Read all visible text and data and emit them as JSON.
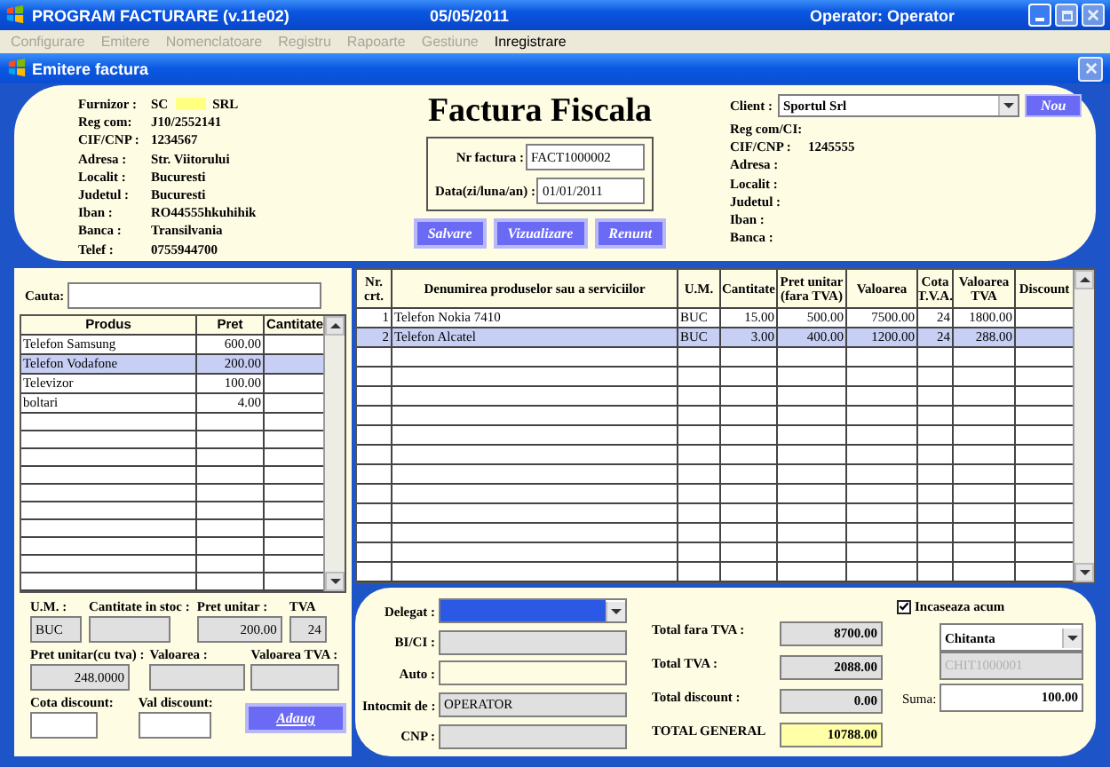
{
  "app": {
    "title": "PROGRAM FACTURARE  (v.11e02)",
    "date": "05/05/2011",
    "operator": "Operator:  Operator"
  },
  "menu": [
    {
      "label": "Configurare",
      "disabled": true
    },
    {
      "label": "Emitere",
      "disabled": true
    },
    {
      "label": "Nomenclatoare",
      "disabled": true
    },
    {
      "label": "Registru",
      "disabled": true
    },
    {
      "label": "Rapoarte",
      "disabled": true
    },
    {
      "label": "Gestiune",
      "disabled": true
    },
    {
      "label": "Inregistrare",
      "disabled": false
    }
  ],
  "window": {
    "title": "Emitere factura"
  },
  "supplier": [
    {
      "label": "Furnizor :",
      "value": "SC",
      "redacted": true,
      "suffix": "SRL"
    },
    {
      "label": "Reg com:",
      "value": "J10/2552141"
    },
    {
      "label": "CIF/CNP :",
      "value": "1234567"
    },
    {
      "label": "Adresa :",
      "value": "Str. Viitorului"
    },
    {
      "label": "Localit :",
      "value": "Bucuresti"
    },
    {
      "label": "Judetul :",
      "value": "Bucuresti"
    },
    {
      "label": "Iban :",
      "value": "RO44555hkuhihik"
    },
    {
      "label": "Banca :",
      "value": "Transilvania"
    },
    {
      "label": "Telef :",
      "value": "0755944700"
    }
  ],
  "invoice": {
    "title": "Factura Fiscala",
    "fields": [
      {
        "label": "Nr factura :",
        "value": "FACT1000002"
      },
      {
        "label": "Data(zi/luna/an) :",
        "value": "01/01/2011"
      }
    ],
    "buttons": [
      "Salvare",
      "Vizualizare",
      "Renunt"
    ]
  },
  "client": {
    "label": "Client :",
    "value": "Sportul Srl",
    "button": "Nou",
    "fields": [
      {
        "label": "Reg com/CI:"
      },
      {
        "label": "CIF/CNP :",
        "value": "1245555"
      },
      {
        "label": "Adresa :"
      },
      {
        "label": "Localit :"
      },
      {
        "label": "Judetul :"
      },
      {
        "label": "Iban :"
      },
      {
        "label": "Banca :"
      }
    ]
  },
  "products": {
    "search_label": "Cauta:",
    "columns": [
      "Produs",
      "Pret",
      "Cantitate"
    ],
    "rows": [
      {
        "cells": [
          "Telefon Samsung",
          "600.00"
        ],
        "selected": false
      },
      {
        "cells": [
          "Telefon Vodafone",
          "200.00"
        ],
        "selected": true
      },
      {
        "cells": [
          "Televizor",
          "100.00"
        ],
        "selected": false
      },
      {
        "cells": [
          "boltari",
          "4.00"
        ],
        "selected": false
      }
    ]
  },
  "product_detail": {
    "rows": [
      [
        {
          "label": "U.M. :",
          "value": "BUC"
        },
        {
          "label": "Cantitate in stoc :"
        },
        {
          "label": "Pret unitar :",
          "value": "200.00"
        },
        {
          "label": "TVA",
          "value": "24"
        }
      ],
      [
        {
          "label": "Pret unitar(cu tva) :",
          "value": "248.0000"
        },
        {
          "label": "Valoarea :"
        },
        {
          "label": "Valoarea TVA :"
        }
      ],
      [
        {
          "label": "Cota discount:"
        },
        {
          "label": "Val discount:"
        }
      ]
    ],
    "button": "Adaug"
  },
  "invoice_table": {
    "columns": [
      "Nr. crt.",
      "Denumirea produselor sau a serviciilor",
      "U.M.",
      "Cantitate",
      "Pret unitar (fara TVA)",
      "Valoarea",
      "Cota T.V.A.",
      "Valoarea TVA",
      "Discount"
    ],
    "rows": [
      {
        "cells": [
          "1",
          "Telefon Nokia 7410",
          "BUC",
          "15.00",
          "500.00",
          "7500.00",
          "24",
          "1800.00"
        ],
        "selected": false
      },
      {
        "cells": [
          "2",
          "Telefon Alcatel",
          "BUC",
          "3.00",
          "400.00",
          "1200.00",
          "24",
          "288.00"
        ],
        "selected": true
      }
    ]
  },
  "delegate": [
    {
      "label": "Delegat :",
      "kind": "dropdown"
    },
    {
      "label": "BI/CI :",
      "kind": "readonly"
    },
    {
      "label": "Auto :",
      "kind": "input"
    },
    {
      "label": "Intocmit de :",
      "kind": "readonly",
      "value": "OPERATOR"
    },
    {
      "label": "CNP :",
      "kind": "readonly"
    }
  ],
  "totals": [
    {
      "label": "Total fara TVA :",
      "value": "8700.00",
      "highlight": false
    },
    {
      "label": "Total TVA :",
      "value": "2088.00",
      "highlight": false
    },
    {
      "label": "Total discount :",
      "value": "0.00",
      "highlight": false
    },
    {
      "label": "TOTAL GENERAL",
      "value": "10788.00",
      "highlight": true
    }
  ],
  "payment": {
    "checkbox": {
      "label": "Incaseaza acum",
      "checked": true
    },
    "document_type": "Chitanta",
    "document_number": "CHIT1000001",
    "amount_label": "Suma:",
    "amount": "100.00"
  }
}
